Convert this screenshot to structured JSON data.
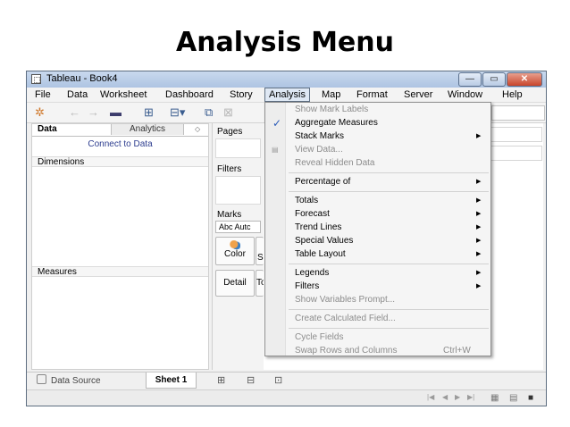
{
  "slide": {
    "title": "Analysis Menu"
  },
  "window": {
    "title": "Tableau - Book4",
    "controls": {
      "minimize": "—",
      "maximize": "▭",
      "close": "✕"
    }
  },
  "menubar": {
    "items": [
      "File",
      "Data",
      "Worksheet",
      "Dashboard",
      "Story",
      "Analysis",
      "Map",
      "Format",
      "Server",
      "Window",
      "Help"
    ],
    "active": "Analysis"
  },
  "toolbar": {
    "icons": [
      "tableau-logo-icon",
      "back-arrow-icon",
      "forward-arrow-icon",
      "save-icon",
      "new-data-source-icon",
      "new-worksheet-icon",
      "duplicate-sheet-icon",
      "clear-sheet-icon"
    ]
  },
  "data_pane": {
    "tabs": [
      "Data",
      "Analytics"
    ],
    "tab_arrow": "◇",
    "connect_link": "Connect to Data",
    "dimensions_header": "Dimensions",
    "measures_header": "Measures"
  },
  "shelves": {
    "pages": "Pages",
    "filters": "Filters",
    "marks": "Marks",
    "marks_type": "Abc Autc",
    "color_card": "Color",
    "size_card": "S",
    "detail_card": "Detail",
    "tooltip_card": "To"
  },
  "analysis_menu": {
    "show_mark_labels": "Show Mark Labels",
    "aggregate_measures": "Aggregate Measures",
    "aggregate_measures_checked": true,
    "stack_marks": "Stack Marks",
    "view_data": "View Data...",
    "reveal_hidden_data": "Reveal Hidden Data",
    "percentage_of": "Percentage of",
    "totals": "Totals",
    "forecast": "Forecast",
    "trend_lines": "Trend Lines",
    "special_values": "Special Values",
    "table_layout": "Table Layout",
    "legends": "Legends",
    "filters": "Filters",
    "show_variables_prompt": "Show Variables Prompt...",
    "create_calculated_field": "Create Calculated Field...",
    "cycle_fields": "Cycle Fields",
    "swap_rows_columns": "Swap Rows and Columns",
    "swap_shortcut": "Ctrl+W",
    "check_glyph": "✓",
    "view_data_icon_glyph": "▤",
    "submenu_arrow": "▶"
  },
  "bottom": {
    "data_source_tab": "Data Source",
    "sheet_tab": "Sheet 1",
    "new_sheet_glyph": "⊞",
    "new_dashboard_glyph": "⊟",
    "new_story_glyph": "⊡"
  },
  "status": {
    "nav_first": "|◀",
    "nav_prev": "◀",
    "nav_next": "▶",
    "nav_last": "▶|",
    "grid_view_glyph": "▦",
    "list_view_glyph": "▤",
    "filmstrip_view_glyph": "■"
  }
}
